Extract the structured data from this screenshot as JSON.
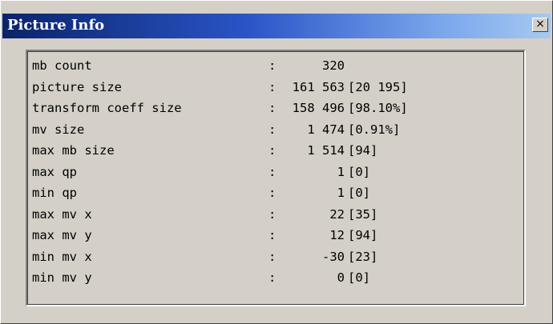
{
  "window": {
    "title": "Picture Info",
    "close_glyph": "×",
    "close_icon": "close-icon"
  },
  "info": {
    "separator": ":",
    "rows": [
      {
        "label": "mb count",
        "value": "320",
        "extra": ""
      },
      {
        "label": "picture size",
        "value": "161 563",
        "extra": "[20 195]"
      },
      {
        "label": "transform coeff size",
        "value": "158 496",
        "extra": "[98.10%]"
      },
      {
        "label": "mv size",
        "value": "1 474",
        "extra": "[0.91%]"
      },
      {
        "label": "max mb size",
        "value": "1 514",
        "extra": "[94]"
      },
      {
        "label": "max qp",
        "value": "1",
        "extra": "[0]"
      },
      {
        "label": "min qp",
        "value": "1",
        "extra": "[0]"
      },
      {
        "label": "max mv x",
        "value": "22",
        "extra": "[35]"
      },
      {
        "label": "max mv y",
        "value": "12",
        "extra": "[94]"
      },
      {
        "label": "min mv x",
        "value": "-30",
        "extra": "[23]"
      },
      {
        "label": "min mv y",
        "value": "0",
        "extra": "[0]"
      }
    ]
  }
}
